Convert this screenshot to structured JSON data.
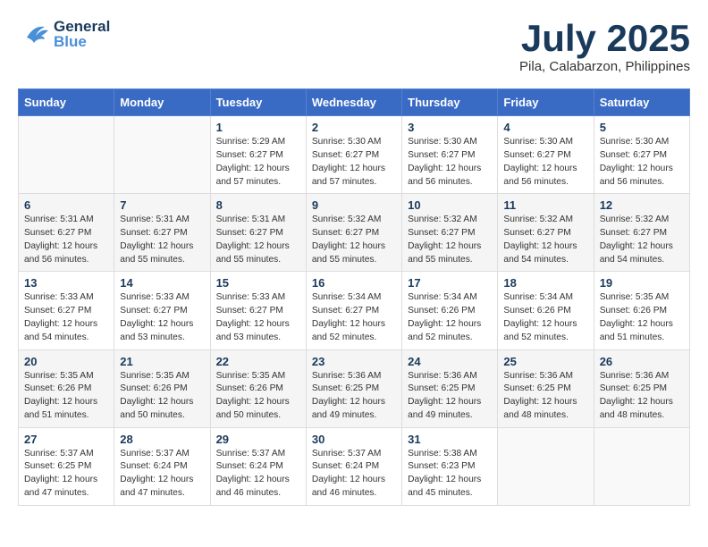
{
  "header": {
    "logo_general": "General",
    "logo_blue": "Blue",
    "month": "July 2025",
    "location": "Pila, Calabarzon, Philippines"
  },
  "weekdays": [
    "Sunday",
    "Monday",
    "Tuesday",
    "Wednesday",
    "Thursday",
    "Friday",
    "Saturday"
  ],
  "weeks": [
    [
      {
        "day": "",
        "info": ""
      },
      {
        "day": "",
        "info": ""
      },
      {
        "day": "1",
        "info": "Sunrise: 5:29 AM\nSunset: 6:27 PM\nDaylight: 12 hours\nand 57 minutes."
      },
      {
        "day": "2",
        "info": "Sunrise: 5:30 AM\nSunset: 6:27 PM\nDaylight: 12 hours\nand 57 minutes."
      },
      {
        "day": "3",
        "info": "Sunrise: 5:30 AM\nSunset: 6:27 PM\nDaylight: 12 hours\nand 56 minutes."
      },
      {
        "day": "4",
        "info": "Sunrise: 5:30 AM\nSunset: 6:27 PM\nDaylight: 12 hours\nand 56 minutes."
      },
      {
        "day": "5",
        "info": "Sunrise: 5:30 AM\nSunset: 6:27 PM\nDaylight: 12 hours\nand 56 minutes."
      }
    ],
    [
      {
        "day": "6",
        "info": "Sunrise: 5:31 AM\nSunset: 6:27 PM\nDaylight: 12 hours\nand 56 minutes."
      },
      {
        "day": "7",
        "info": "Sunrise: 5:31 AM\nSunset: 6:27 PM\nDaylight: 12 hours\nand 55 minutes."
      },
      {
        "day": "8",
        "info": "Sunrise: 5:31 AM\nSunset: 6:27 PM\nDaylight: 12 hours\nand 55 minutes."
      },
      {
        "day": "9",
        "info": "Sunrise: 5:32 AM\nSunset: 6:27 PM\nDaylight: 12 hours\nand 55 minutes."
      },
      {
        "day": "10",
        "info": "Sunrise: 5:32 AM\nSunset: 6:27 PM\nDaylight: 12 hours\nand 55 minutes."
      },
      {
        "day": "11",
        "info": "Sunrise: 5:32 AM\nSunset: 6:27 PM\nDaylight: 12 hours\nand 54 minutes."
      },
      {
        "day": "12",
        "info": "Sunrise: 5:32 AM\nSunset: 6:27 PM\nDaylight: 12 hours\nand 54 minutes."
      }
    ],
    [
      {
        "day": "13",
        "info": "Sunrise: 5:33 AM\nSunset: 6:27 PM\nDaylight: 12 hours\nand 54 minutes."
      },
      {
        "day": "14",
        "info": "Sunrise: 5:33 AM\nSunset: 6:27 PM\nDaylight: 12 hours\nand 53 minutes."
      },
      {
        "day": "15",
        "info": "Sunrise: 5:33 AM\nSunset: 6:27 PM\nDaylight: 12 hours\nand 53 minutes."
      },
      {
        "day": "16",
        "info": "Sunrise: 5:34 AM\nSunset: 6:27 PM\nDaylight: 12 hours\nand 52 minutes."
      },
      {
        "day": "17",
        "info": "Sunrise: 5:34 AM\nSunset: 6:26 PM\nDaylight: 12 hours\nand 52 minutes."
      },
      {
        "day": "18",
        "info": "Sunrise: 5:34 AM\nSunset: 6:26 PM\nDaylight: 12 hours\nand 52 minutes."
      },
      {
        "day": "19",
        "info": "Sunrise: 5:35 AM\nSunset: 6:26 PM\nDaylight: 12 hours\nand 51 minutes."
      }
    ],
    [
      {
        "day": "20",
        "info": "Sunrise: 5:35 AM\nSunset: 6:26 PM\nDaylight: 12 hours\nand 51 minutes."
      },
      {
        "day": "21",
        "info": "Sunrise: 5:35 AM\nSunset: 6:26 PM\nDaylight: 12 hours\nand 50 minutes."
      },
      {
        "day": "22",
        "info": "Sunrise: 5:35 AM\nSunset: 6:26 PM\nDaylight: 12 hours\nand 50 minutes."
      },
      {
        "day": "23",
        "info": "Sunrise: 5:36 AM\nSunset: 6:25 PM\nDaylight: 12 hours\nand 49 minutes."
      },
      {
        "day": "24",
        "info": "Sunrise: 5:36 AM\nSunset: 6:25 PM\nDaylight: 12 hours\nand 49 minutes."
      },
      {
        "day": "25",
        "info": "Sunrise: 5:36 AM\nSunset: 6:25 PM\nDaylight: 12 hours\nand 48 minutes."
      },
      {
        "day": "26",
        "info": "Sunrise: 5:36 AM\nSunset: 6:25 PM\nDaylight: 12 hours\nand 48 minutes."
      }
    ],
    [
      {
        "day": "27",
        "info": "Sunrise: 5:37 AM\nSunset: 6:25 PM\nDaylight: 12 hours\nand 47 minutes."
      },
      {
        "day": "28",
        "info": "Sunrise: 5:37 AM\nSunset: 6:24 PM\nDaylight: 12 hours\nand 47 minutes."
      },
      {
        "day": "29",
        "info": "Sunrise: 5:37 AM\nSunset: 6:24 PM\nDaylight: 12 hours\nand 46 minutes."
      },
      {
        "day": "30",
        "info": "Sunrise: 5:37 AM\nSunset: 6:24 PM\nDaylight: 12 hours\nand 46 minutes."
      },
      {
        "day": "31",
        "info": "Sunrise: 5:38 AM\nSunset: 6:23 PM\nDaylight: 12 hours\nand 45 minutes."
      },
      {
        "day": "",
        "info": ""
      },
      {
        "day": "",
        "info": ""
      }
    ]
  ]
}
